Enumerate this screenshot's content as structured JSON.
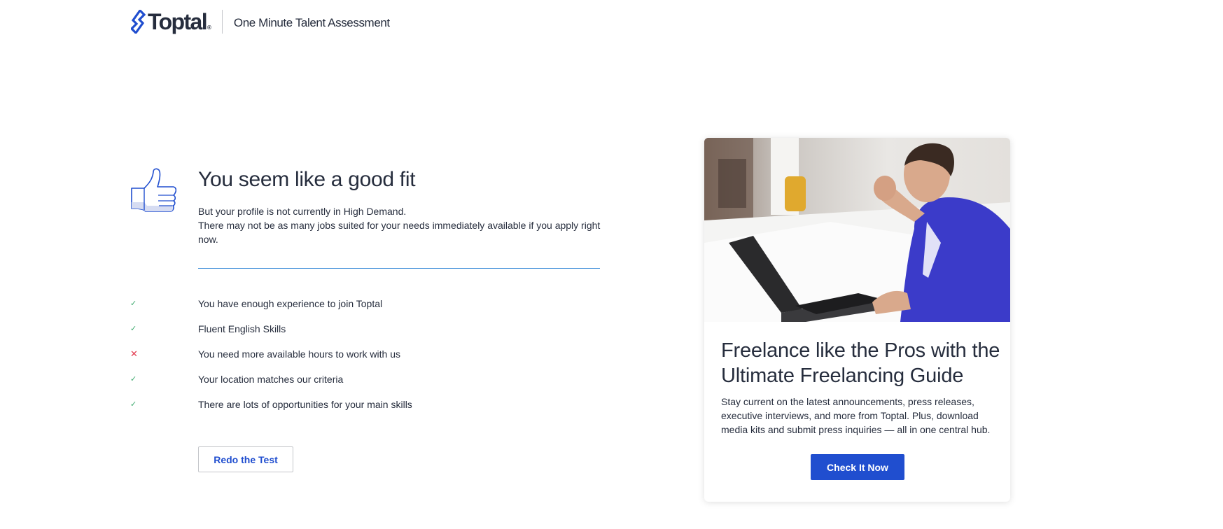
{
  "header": {
    "logo_text": "Toptal",
    "logo_reg": "®",
    "subtitle": "One Minute Talent Assessment"
  },
  "result": {
    "icon": "thumbs-up-icon",
    "title": "You seem like a good fit",
    "description_line1": "But your profile is not currently in High Demand.",
    "description_line2": "There may not be as many jobs suited for your needs immediately available if you apply right now.",
    "criteria": [
      {
        "status": "pass",
        "mark": "✓",
        "label": "You have enough experience to join Toptal"
      },
      {
        "status": "pass",
        "mark": "✓",
        "label": "Fluent English Skills"
      },
      {
        "status": "fail",
        "mark": "✕",
        "label": "You need more available hours to work with us"
      },
      {
        "status": "pass",
        "mark": "✓",
        "label": "Your location matches our criteria"
      },
      {
        "status": "pass",
        "mark": "✓",
        "label": "There are lots of opportunities for your main skills"
      }
    ],
    "redo_button": "Redo the Test"
  },
  "promo": {
    "image": "photo-man-with-laptop",
    "title": "Freelance like the Pros with the Ultimate Freelancing Guide",
    "text": "Stay current on the latest announcements, press releases, executive interviews, and more from Toptal. Plus, download media kits and submit press inquiries — all in one central hub.",
    "button": "Check It Now"
  },
  "colors": {
    "brand_blue": "#204ecf",
    "text_dark": "#262d3d",
    "divider_blue": "#3d8ed9",
    "pass_green": "#3aa86b",
    "fail_red": "#e23a4f"
  }
}
